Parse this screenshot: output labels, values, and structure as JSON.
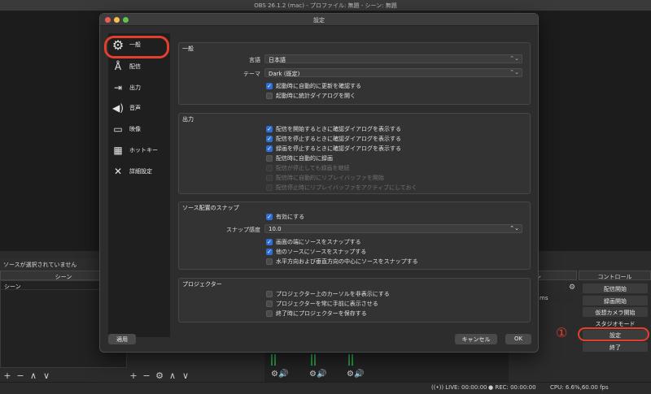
{
  "app": {
    "window_title": "OBS 26.1.2 (mac) - プロファイル: 無題 - シーン: 無題"
  },
  "main": {
    "source_status": "ソースが選択されていません",
    "scenes_header": "シーン",
    "scene_items": [
      "シーン"
    ],
    "transition_header": "ンジション",
    "transition_value": "ms",
    "controls_header": "コントロール",
    "controls": {
      "start_stream": "配信開始",
      "start_record": "録画開始",
      "virtual_camera": "仮想カメラ開始",
      "studio_mode": "スタジオモード",
      "settings": "設定",
      "exit": "終了"
    },
    "annotation_marker": "①",
    "status": {
      "live": "LIVE: 00:00:00",
      "rec": "REC: 00:00:00",
      "cpu": "CPU: 6.6%,60.00 fps"
    },
    "list_buttons": {
      "add": "+",
      "remove": "−",
      "up": "∧",
      "down": "∨",
      "gear": "⚙"
    }
  },
  "settings_dialog": {
    "title": "設定",
    "sidebar": [
      {
        "label": "一般",
        "icon": "gear-icon",
        "glyph": "⚙"
      },
      {
        "label": "配信",
        "icon": "antenna-icon",
        "glyph": "📡"
      },
      {
        "label": "出力",
        "icon": "output-icon",
        "glyph": "⇥"
      },
      {
        "label": "音声",
        "icon": "speaker-icon",
        "glyph": "🔊"
      },
      {
        "label": "映像",
        "icon": "monitor-icon",
        "glyph": "🖥"
      },
      {
        "label": "ホットキー",
        "icon": "keyboard-icon",
        "glyph": "⌨"
      },
      {
        "label": "詳細設定",
        "icon": "tools-icon",
        "glyph": "✕"
      }
    ],
    "general": {
      "title": "一般",
      "language_label": "言語",
      "language_value": "日本語",
      "theme_label": "テーマ",
      "theme_value": "Dark (既定)",
      "check_updates": "起動時に自動的に更新を確認する",
      "open_stats": "起動時に統計ダイアログを開く"
    },
    "output": {
      "title": "出力",
      "confirm_start_stream": "配信を開始するときに確認ダイアログを表示する",
      "confirm_stop_stream": "配信を停止するときに確認ダイアログを表示する",
      "confirm_stop_record": "録画を停止するときに確認ダイアログを表示する",
      "record_when_streaming": "配信時に自動的に録画",
      "keep_recording": "配信が停止しても録画を継続",
      "replay_buffer_auto": "配信時に自動的にリプレイバッファを開始",
      "replay_buffer_active": "配信停止時にリプレイバッファをアクティブにしておく"
    },
    "snapping": {
      "title": "ソース配置のスナップ",
      "enable": "有効にする",
      "sensitivity_label": "スナップ感度",
      "sensitivity_value": "10.0",
      "snap_screen_edge": "画面の端にソースをスナップする",
      "snap_other_sources": "他のソースにソースをスナップする",
      "snap_center": "水平方向および垂直方向の中心にソースをスナップする"
    },
    "projectors": {
      "title": "プロジェクター",
      "hide_cursor": "プロジェクター上のカーソルを非表示にする",
      "always_on_top": "プロジェクターを常に手前に表示させる",
      "save_on_exit": "終了時にプロジェクターを保存する"
    },
    "buttons": {
      "apply": "適用",
      "cancel": "キャンセル",
      "ok": "OK"
    },
    "check_glyph": "✓",
    "select_arrow": "⌃⌄"
  }
}
